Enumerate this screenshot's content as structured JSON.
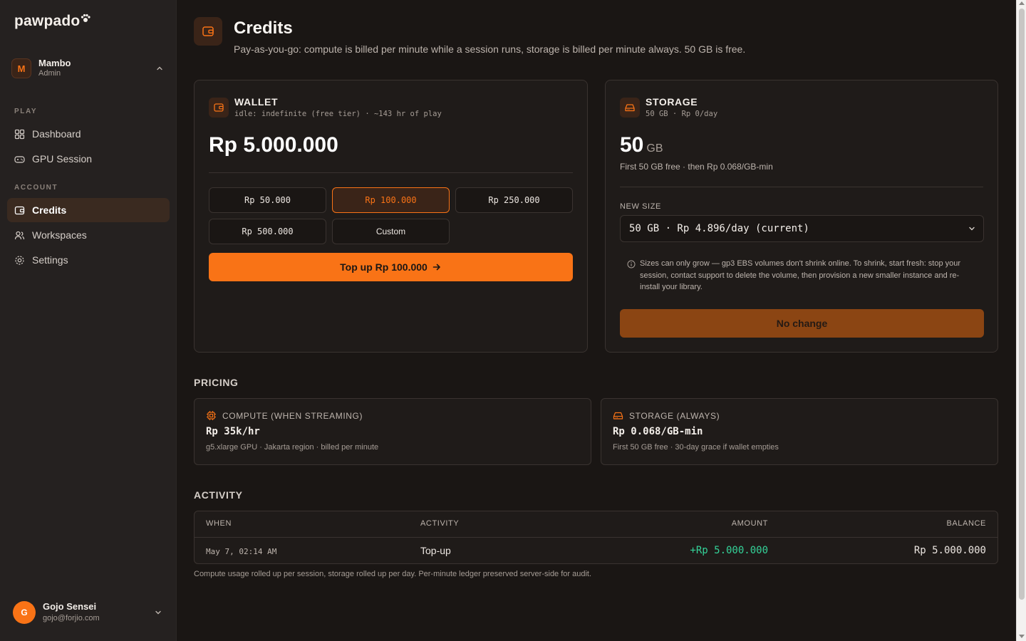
{
  "app": {
    "logo_text": "pawpado"
  },
  "account": {
    "initial": "M",
    "name": "Mambo",
    "role": "Admin"
  },
  "nav": {
    "play_section": "PLAY",
    "dashboard": "Dashboard",
    "gpu_session": "GPU Session",
    "account_section": "ACCOUNT",
    "credits": "Credits",
    "workspaces": "Workspaces",
    "settings": "Settings"
  },
  "user": {
    "initial": "G",
    "name": "Gojo Sensei",
    "email": "gojo@forjio.com"
  },
  "page": {
    "title": "Credits",
    "subtitle": "Pay-as-you-go: compute is billed per minute while a session runs, storage is billed per minute always. 50 GB is free."
  },
  "wallet": {
    "title": "WALLET",
    "status": "idle: indefinite (free tier) · ~143 hr of play",
    "balance": "Rp 5.000.000",
    "amounts": [
      "Rp 50.000",
      "Rp 100.000",
      "Rp 250.000",
      "Rp 500.000",
      "Custom"
    ],
    "selected_amount": "Rp 100.000",
    "topup_label": "Top up Rp 100.000"
  },
  "storage": {
    "title": "STORAGE",
    "status": "50 GB · Rp 0/day",
    "size_value": "50",
    "size_unit": "GB",
    "free_note": "First 50 GB free · then Rp 0.068/GB-min",
    "new_size_label": "NEW SIZE",
    "selected_option": "50 GB · Rp 4.896/day (current)",
    "note": "Sizes can only grow — gp3 EBS volumes don't shrink online. To shrink, start fresh: stop your session, contact support to delete the volume, then provision a new smaller instance and re-install your library.",
    "action_label": "No change"
  },
  "pricing": {
    "heading": "PRICING",
    "compute": {
      "title": "COMPUTE (WHEN STREAMING)",
      "price": "Rp 35k/hr",
      "detail": "g5.xlarge GPU · Jakarta region · billed per minute"
    },
    "storage": {
      "title": "STORAGE (ALWAYS)",
      "price": "Rp 0.068/GB-min",
      "detail": "First 50 GB free · 30-day grace if wallet empties"
    }
  },
  "activity": {
    "heading": "ACTIVITY",
    "columns": {
      "when": "WHEN",
      "activity": "ACTIVITY",
      "amount": "AMOUNT",
      "balance": "BALANCE"
    },
    "rows": [
      {
        "when": "May 7, 02:14 AM",
        "activity": "Top-up",
        "amount": "+Rp 5.000.000",
        "balance": "Rp 5.000.000"
      }
    ],
    "footnote": "Compute usage rolled up per session, storage rolled up per day. Per-minute ledger preserved server-side for audit."
  },
  "colors": {
    "accent": "#f97316",
    "positive": "#34d399",
    "background": "#1a1614",
    "sidebar": "#252120"
  }
}
